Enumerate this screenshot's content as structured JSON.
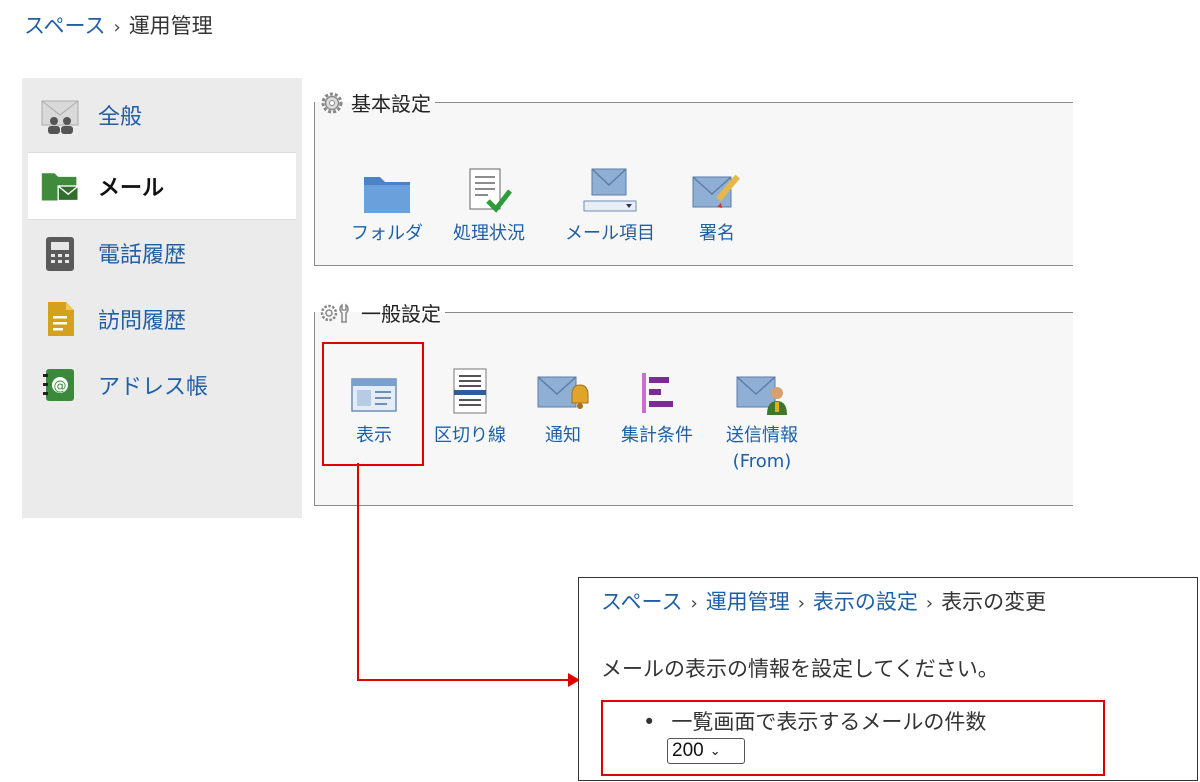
{
  "breadcrumb_top": {
    "root": "スペース",
    "current": "運用管理",
    "separator": "›"
  },
  "sidebar": {
    "items": [
      {
        "label": "全般",
        "icon": "users-mail-icon"
      },
      {
        "label": "メール",
        "icon": "mail-folder-icon",
        "active": true
      },
      {
        "label": "電話履歴",
        "icon": "phone-icon"
      },
      {
        "label": "訪問履歴",
        "icon": "document-icon"
      },
      {
        "label": "アドレス帳",
        "icon": "address-book-icon"
      }
    ]
  },
  "basic_settings": {
    "legend": "基本設定",
    "items": [
      {
        "label": "フォルダ",
        "icon": "folder-icon"
      },
      {
        "label": "処理状況",
        "icon": "status-checklist-icon"
      },
      {
        "label": "メール項目",
        "icon": "mail-fields-icon"
      },
      {
        "label": "署名",
        "icon": "signature-icon"
      }
    ]
  },
  "general_settings": {
    "legend": "一般設定",
    "items": [
      {
        "label": "表示",
        "icon": "display-icon",
        "highlighted": true
      },
      {
        "label": "区切り線",
        "icon": "divider-icon"
      },
      {
        "label": "通知",
        "icon": "notify-bell-icon"
      },
      {
        "label": "集計条件",
        "icon": "aggregate-icon"
      },
      {
        "label": "送信情報",
        "label2": "(From)",
        "icon": "sender-info-icon"
      }
    ]
  },
  "detail": {
    "breadcrumb": [
      "スペース",
      "運用管理",
      "表示の設定"
    ],
    "breadcrumb_current": "表示の変更",
    "description": "メールの表示の情報を設定してください。",
    "option_label": "一覧画面で表示するメールの件数",
    "count_value": "200"
  },
  "colors": {
    "highlight": "#e00000",
    "link": "#1f5fa6"
  }
}
